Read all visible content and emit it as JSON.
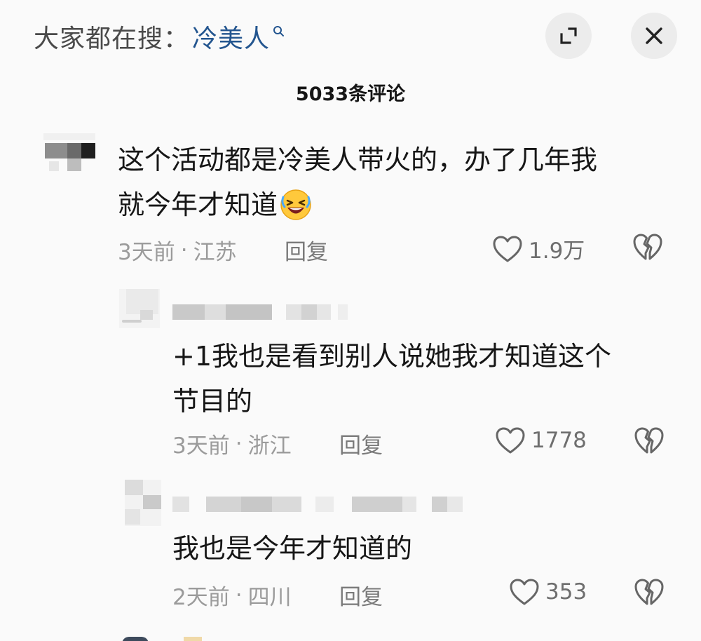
{
  "header": {
    "search_prefix": "大家都在搜：",
    "search_keyword": "冷美人",
    "comment_count": "5033条评论"
  },
  "comments": [
    {
      "text_line1": "这个活动都是冷美人带火的，办了几年我",
      "text_line2": "就今年才知道",
      "emoji": "grinning-squinting-face",
      "time": "3天前",
      "location": "江苏",
      "reply_label": "回复",
      "likes": "1.9万"
    },
    {
      "text_line1": "+1我也是看到别人说她我才知道这个",
      "text_line2": "节目的",
      "time": "3天前",
      "location": "浙江",
      "reply_label": "回复",
      "likes": "1778"
    },
    {
      "text_line1": "我也是今年才知道的",
      "time": "2天前",
      "location": "四川",
      "reply_label": "回复",
      "likes": "353"
    }
  ],
  "meta_separator": "·",
  "colors": {
    "search_keyword": "#23558f",
    "meta_gray": "#9b9b9b",
    "background": "#fafafa"
  }
}
